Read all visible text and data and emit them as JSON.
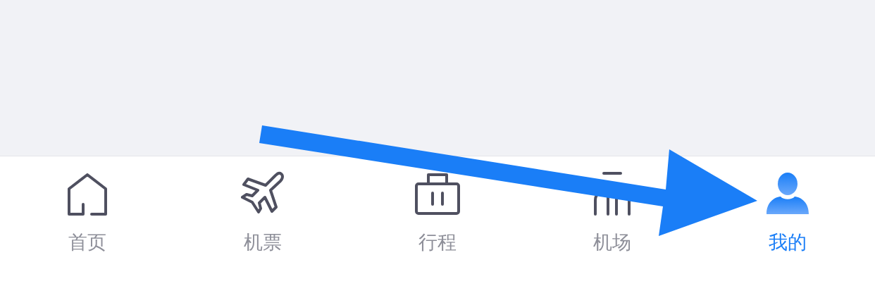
{
  "tab_bar": {
    "tabs": [
      {
        "label": "首页",
        "selected": false
      },
      {
        "label": "机票",
        "selected": false
      },
      {
        "label": "行程",
        "selected": false
      },
      {
        "label": "机场",
        "selected": false
      },
      {
        "label": "我的",
        "selected": true
      }
    ]
  }
}
